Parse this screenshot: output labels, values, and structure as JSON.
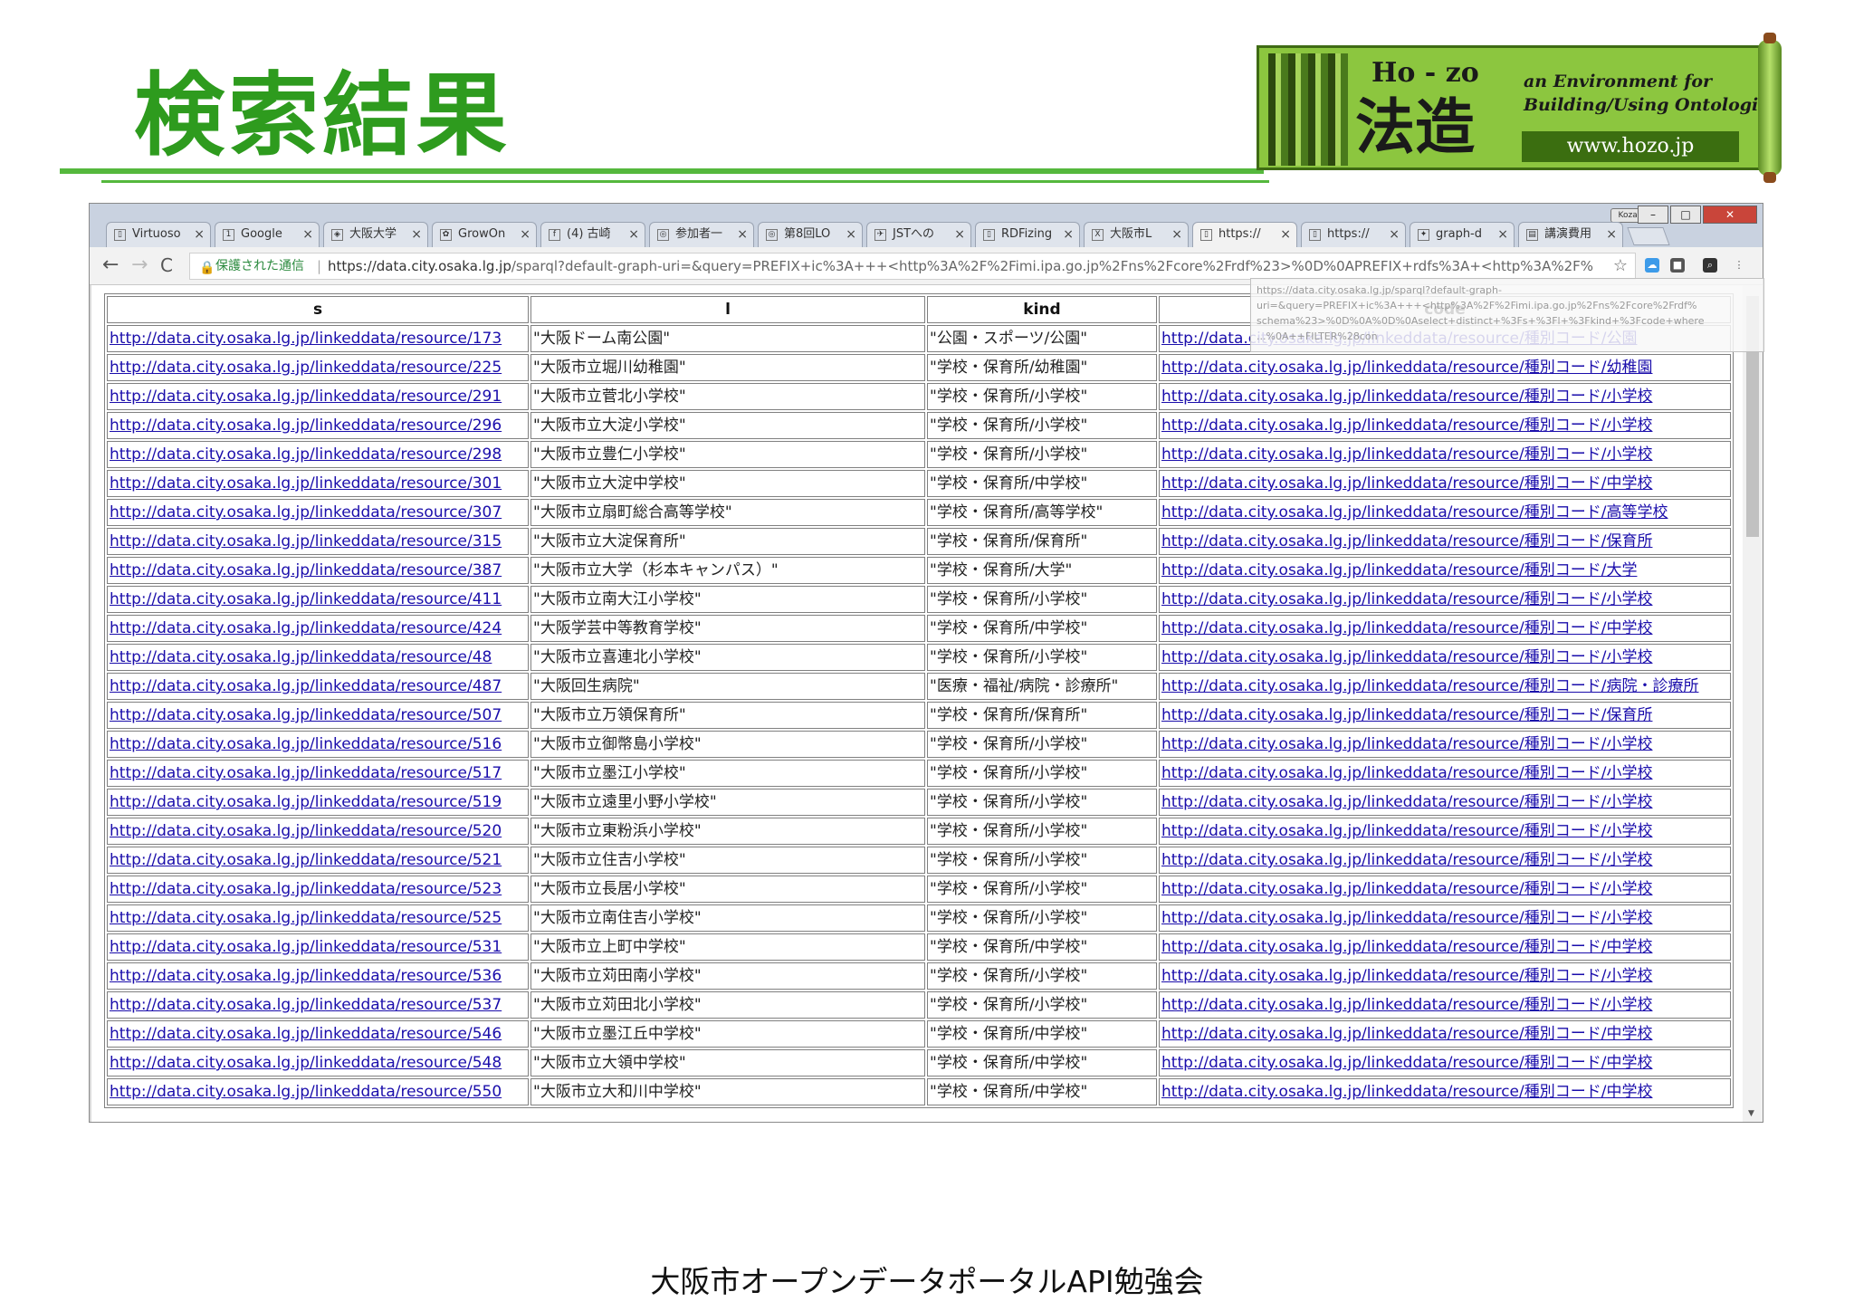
{
  "slide": {
    "title": "検索結果",
    "footer": "大阪市オープンデータポータルAPI勉強会"
  },
  "logo": {
    "hozo": "Ho - zo",
    "kanji": "法造",
    "tagline": "an Environment for\nBuilding/Using Ontologies",
    "url": "www.hozo.jp"
  },
  "browser": {
    "user_badge": "Kozaki",
    "window_buttons": [
      "–",
      "□",
      "✕"
    ],
    "tabs": [
      {
        "label": "Virtuoso",
        "icon": "page-icon"
      },
      {
        "label": "Google",
        "icon": "google-icon"
      },
      {
        "label": "大阪大学",
        "icon": "university-icon"
      },
      {
        "label": "GrowOn",
        "icon": "growon-icon"
      },
      {
        "label": "(4) 古崎",
        "icon": "facebook-icon"
      },
      {
        "label": "参加者一",
        "icon": "connpass-icon"
      },
      {
        "label": "第8回LO",
        "icon": "connpass-icon"
      },
      {
        "label": "JSTへの",
        "icon": "jst-icon"
      },
      {
        "label": "RDFizing",
        "icon": "page-icon"
      },
      {
        "label": "大阪市L",
        "icon": "spreadsheet-icon"
      },
      {
        "label": "https://",
        "icon": "page-icon",
        "active": true
      },
      {
        "label": "https://",
        "icon": "page-icon"
      },
      {
        "label": "graph-d",
        "icon": "puzzle-icon"
      },
      {
        "label": "講演費用",
        "icon": "document-icon"
      }
    ],
    "nav": {
      "back": "←",
      "forward": "→",
      "reload": "C"
    },
    "security_label": "保護された通信",
    "url_host": "https://data.city.osaka.lg.jp",
    "url_rest": "/sparql?default-graph-uri=&query=PREFIX+ic%3A+++<http%3A%2F%2Fimi.ipa.go.jp%2Fns%2Fcore%2Frdf%23>%0D%0APREFIX+rdfs%3A+<http%3A%2F%",
    "tooltip_lines": [
      "https://data.city.osaka.lg.jp/sparql?default-graph-",
      "uri=&query=PREFIX+ic%3A+++<http%3A%2F%2Fimi.ipa.go.jp%2Fns%2Fcore%2Frdf%",
      "schema%23>%0D%0A%0D%0Aselect+distinct+%3Fs+%3Fl+%3Fkind+%3Fcode+where",
      "...%0A++FILTER%28con"
    ]
  },
  "results": {
    "headers": [
      "s",
      "l",
      "kind",
      "code"
    ],
    "rows": [
      [
        "http://data.city.osaka.lg.jp/linkeddata/resource/173",
        "\"大阪ドーム南公園\"",
        "\"公園・スポーツ/公園\"",
        "http://data.city.osaka.lg.jp/linkeddata/resource/種別コード/公園"
      ],
      [
        "http://data.city.osaka.lg.jp/linkeddata/resource/225",
        "\"大阪市立堀川幼稚園\"",
        "\"学校・保育所/幼稚園\"",
        "http://data.city.osaka.lg.jp/linkeddata/resource/種別コード/幼稚園"
      ],
      [
        "http://data.city.osaka.lg.jp/linkeddata/resource/291",
        "\"大阪市立菅北小学校\"",
        "\"学校・保育所/小学校\"",
        "http://data.city.osaka.lg.jp/linkeddata/resource/種別コード/小学校"
      ],
      [
        "http://data.city.osaka.lg.jp/linkeddata/resource/296",
        "\"大阪市立大淀小学校\"",
        "\"学校・保育所/小学校\"",
        "http://data.city.osaka.lg.jp/linkeddata/resource/種別コード/小学校"
      ],
      [
        "http://data.city.osaka.lg.jp/linkeddata/resource/298",
        "\"大阪市立豊仁小学校\"",
        "\"学校・保育所/小学校\"",
        "http://data.city.osaka.lg.jp/linkeddata/resource/種別コード/小学校"
      ],
      [
        "http://data.city.osaka.lg.jp/linkeddata/resource/301",
        "\"大阪市立大淀中学校\"",
        "\"学校・保育所/中学校\"",
        "http://data.city.osaka.lg.jp/linkeddata/resource/種別コード/中学校"
      ],
      [
        "http://data.city.osaka.lg.jp/linkeddata/resource/307",
        "\"大阪市立扇町総合高等学校\"",
        "\"学校・保育所/高等学校\"",
        "http://data.city.osaka.lg.jp/linkeddata/resource/種別コード/高等学校"
      ],
      [
        "http://data.city.osaka.lg.jp/linkeddata/resource/315",
        "\"大阪市立大淀保育所\"",
        "\"学校・保育所/保育所\"",
        "http://data.city.osaka.lg.jp/linkeddata/resource/種別コード/保育所"
      ],
      [
        "http://data.city.osaka.lg.jp/linkeddata/resource/387",
        "\"大阪市立大学（杉本キャンパス）\"",
        "\"学校・保育所/大学\"",
        "http://data.city.osaka.lg.jp/linkeddata/resource/種別コード/大学"
      ],
      [
        "http://data.city.osaka.lg.jp/linkeddata/resource/411",
        "\"大阪市立南大江小学校\"",
        "\"学校・保育所/小学校\"",
        "http://data.city.osaka.lg.jp/linkeddata/resource/種別コード/小学校"
      ],
      [
        "http://data.city.osaka.lg.jp/linkeddata/resource/424",
        "\"大阪学芸中等教育学校\"",
        "\"学校・保育所/中学校\"",
        "http://data.city.osaka.lg.jp/linkeddata/resource/種別コード/中学校"
      ],
      [
        "http://data.city.osaka.lg.jp/linkeddata/resource/48",
        "\"大阪市立喜連北小学校\"",
        "\"学校・保育所/小学校\"",
        "http://data.city.osaka.lg.jp/linkeddata/resource/種別コード/小学校"
      ],
      [
        "http://data.city.osaka.lg.jp/linkeddata/resource/487",
        "\"大阪回生病院\"",
        "\"医療・福祉/病院・診療所\"",
        "http://data.city.osaka.lg.jp/linkeddata/resource/種別コード/病院・診療所"
      ],
      [
        "http://data.city.osaka.lg.jp/linkeddata/resource/507",
        "\"大阪市立万領保育所\"",
        "\"学校・保育所/保育所\"",
        "http://data.city.osaka.lg.jp/linkeddata/resource/種別コード/保育所"
      ],
      [
        "http://data.city.osaka.lg.jp/linkeddata/resource/516",
        "\"大阪市立御幣島小学校\"",
        "\"学校・保育所/小学校\"",
        "http://data.city.osaka.lg.jp/linkeddata/resource/種別コード/小学校"
      ],
      [
        "http://data.city.osaka.lg.jp/linkeddata/resource/517",
        "\"大阪市立墨江小学校\"",
        "\"学校・保育所/小学校\"",
        "http://data.city.osaka.lg.jp/linkeddata/resource/種別コード/小学校"
      ],
      [
        "http://data.city.osaka.lg.jp/linkeddata/resource/519",
        "\"大阪市立遠里小野小学校\"",
        "\"学校・保育所/小学校\"",
        "http://data.city.osaka.lg.jp/linkeddata/resource/種別コード/小学校"
      ],
      [
        "http://data.city.osaka.lg.jp/linkeddata/resource/520",
        "\"大阪市立東粉浜小学校\"",
        "\"学校・保育所/小学校\"",
        "http://data.city.osaka.lg.jp/linkeddata/resource/種別コード/小学校"
      ],
      [
        "http://data.city.osaka.lg.jp/linkeddata/resource/521",
        "\"大阪市立住吉小学校\"",
        "\"学校・保育所/小学校\"",
        "http://data.city.osaka.lg.jp/linkeddata/resource/種別コード/小学校"
      ],
      [
        "http://data.city.osaka.lg.jp/linkeddata/resource/523",
        "\"大阪市立長居小学校\"",
        "\"学校・保育所/小学校\"",
        "http://data.city.osaka.lg.jp/linkeddata/resource/種別コード/小学校"
      ],
      [
        "http://data.city.osaka.lg.jp/linkeddata/resource/525",
        "\"大阪市立南住吉小学校\"",
        "\"学校・保育所/小学校\"",
        "http://data.city.osaka.lg.jp/linkeddata/resource/種別コード/小学校"
      ],
      [
        "http://data.city.osaka.lg.jp/linkeddata/resource/531",
        "\"大阪市立上町中学校\"",
        "\"学校・保育所/中学校\"",
        "http://data.city.osaka.lg.jp/linkeddata/resource/種別コード/中学校"
      ],
      [
        "http://data.city.osaka.lg.jp/linkeddata/resource/536",
        "\"大阪市立苅田南小学校\"",
        "\"学校・保育所/小学校\"",
        "http://data.city.osaka.lg.jp/linkeddata/resource/種別コード/小学校"
      ],
      [
        "http://data.city.osaka.lg.jp/linkeddata/resource/537",
        "\"大阪市立苅田北小学校\"",
        "\"学校・保育所/小学校\"",
        "http://data.city.osaka.lg.jp/linkeddata/resource/種別コード/小学校"
      ],
      [
        "http://data.city.osaka.lg.jp/linkeddata/resource/546",
        "\"大阪市立墨江丘中学校\"",
        "\"学校・保育所/中学校\"",
        "http://data.city.osaka.lg.jp/linkeddata/resource/種別コード/中学校"
      ],
      [
        "http://data.city.osaka.lg.jp/linkeddata/resource/548",
        "\"大阪市立大領中学校\"",
        "\"学校・保育所/中学校\"",
        "http://data.city.osaka.lg.jp/linkeddata/resource/種別コード/中学校"
      ],
      [
        "http://data.city.osaka.lg.jp/linkeddata/resource/550",
        "\"大阪市立大和川中学校\"",
        "\"学校・保育所/中学校\"",
        "http://data.city.osaka.lg.jp/linkeddata/resource/種別コード/中学校"
      ]
    ]
  },
  "colors": {
    "title_green": "#2e9b1e",
    "rule_green": "#55b83d",
    "link": "#1a0dab",
    "secure_green": "#2b8a3e"
  }
}
